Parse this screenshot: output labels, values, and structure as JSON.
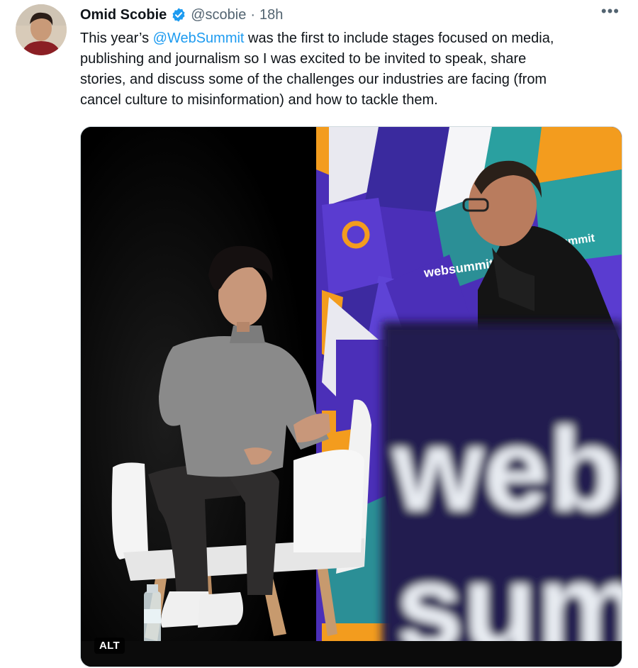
{
  "tweet": {
    "author": {
      "display_name": "Omid Scobie",
      "handle": "@scobie",
      "verified": true
    },
    "separator": "·",
    "timestamp": "18h",
    "more_icon": "more-horizontal-icon",
    "text_lines": [
      {
        "before": "This year’s ",
        "mention": "@WebSummit",
        "after": " was the first to include stages focused on media,"
      },
      {
        "before": "publishing and journalism so I was excited to be invited to speak, share"
      },
      {
        "before": "stories, and discuss some of the challenges our industries are facing (from"
      },
      {
        "before": "cancel culture to misinformation) and how to tackle them."
      }
    ],
    "media": {
      "alt_badge": "ALT",
      "stage_logo": "websummit",
      "stage_logo_partial": "ummit",
      "blurred_sign_line1": "web",
      "blurred_sign_line2": "sum"
    }
  },
  "colors": {
    "accent": "#1d9bf0",
    "text": "#0f1419",
    "muted": "#536471"
  }
}
